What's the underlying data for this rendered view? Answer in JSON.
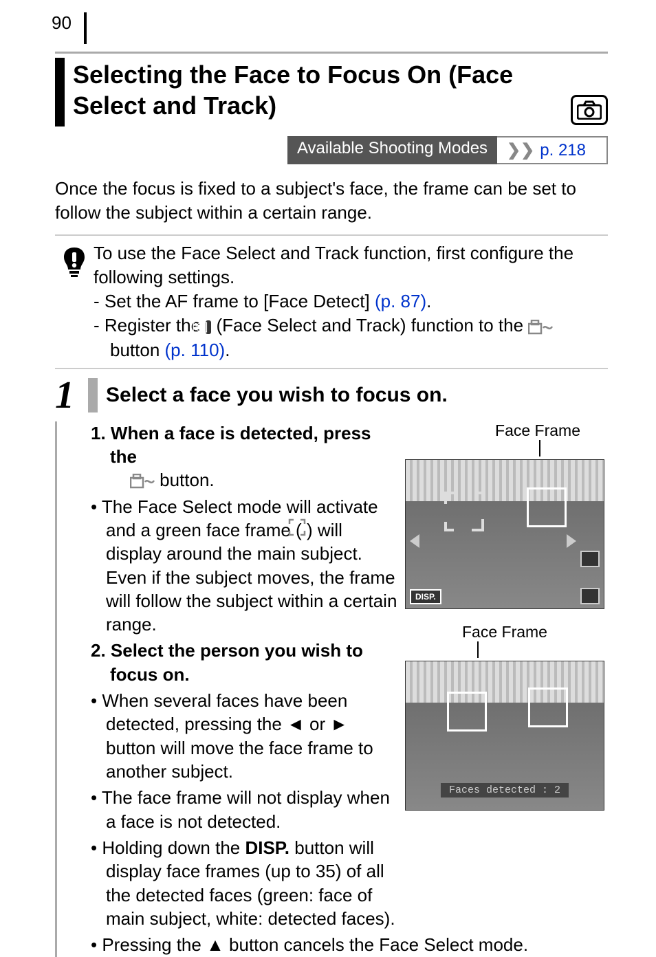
{
  "pageNumber": "90",
  "title": "Selecting the Face to Focus On (Face Select and Track)",
  "modesBar": {
    "label": "Available Shooting Modes",
    "linkText": "p. 218"
  },
  "intro": "Once the focus is fixed to a subject's face, the frame can be set to follow the subject within a certain range.",
  "notice": {
    "lead": "To use the Face Select and Track function, first configure the following settings.",
    "item1_prefix": "- Set the AF frame to [Face Detect] ",
    "item1_link": "(p. 87)",
    "item1_suffix": ".",
    "item2_prefix": "- Register the ",
    "item2_mid": " (Face Select and Track) function to the ",
    "item2_btn_prefix": "button ",
    "item2_link": "(p. 110)",
    "item2_suffix": "."
  },
  "step": {
    "number": "1",
    "title": "Select a face you wish to focus on.",
    "p1_prefix": "1. When a face is detected, press the",
    "p1_suffix": " button.",
    "b1": "• The Face Select mode will activate and a green face frame (       ) will display around the main subject. Even if the subject moves, the frame will follow the subject within a certain range.",
    "p2": "2. Select the person you wish to focus on.",
    "b2": "• When several faces have been detected, pressing the ◄ or ► button will move the face frame to another subject.",
    "b3": "• The face frame will not display when a face is not detected.",
    "b4_prefix": "• Holding down the ",
    "b4_disp": "DISP.",
    "b4_suffix": " button will display face frames (up to 35) of all the detected faces (green: face of main subject, white: detected faces).",
    "b5": "• Pressing the ▲ button cancels the Face Select mode."
  },
  "images": {
    "label1": "Face Frame",
    "dispBadge": "DISP.",
    "label2": "Face Frame",
    "facesDetected": "Faces detected : 2"
  },
  "icons": {
    "camera": "camera-icon",
    "exclaim": "important-icon",
    "faceSelect": "face-select-icon",
    "printShare": "print-share-icon",
    "frameCorners": "frame-corners-icon"
  }
}
